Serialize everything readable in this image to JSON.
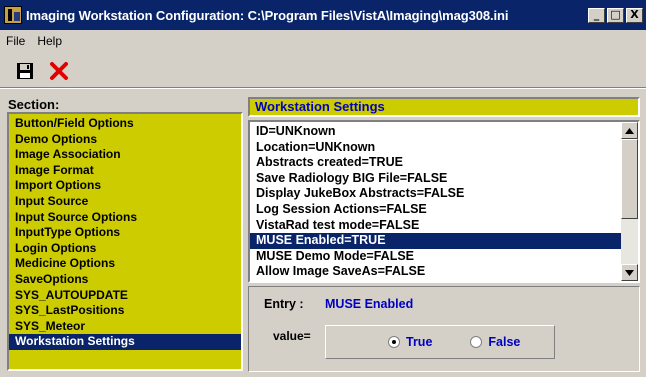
{
  "window": {
    "title": "Imaging Workstation Configuration:  C:\\Program Files\\VistA\\Imaging\\mag308.ini",
    "minimize_glyph": "_",
    "maximize_glyph": "□",
    "close_glyph": "X"
  },
  "menu": [
    "File",
    "Help"
  ],
  "toolbar": {
    "save_icon": "floppy-disk-icon",
    "cancel_icon": "red-x-icon"
  },
  "section": {
    "label": "Section:",
    "items": [
      "Button/Field Options",
      "Demo Options",
      "Image Association",
      "Image Format",
      "Import Options",
      "Input Source",
      "Input Source Options",
      "InputType Options",
      "Login Options",
      "Medicine Options",
      "SaveOptions",
      "SYS_AUTOUPDATE",
      "SYS_LastPositions",
      "SYS_Meteor",
      "Workstation Settings"
    ],
    "selected_index": 14
  },
  "settings": {
    "header": "Workstation Settings",
    "items": [
      "ID=UNKnown",
      "Location=UNKnown",
      "Abstracts created=TRUE",
      "Save Radiology BIG File=FALSE",
      "Display JukeBox Abstracts=FALSE",
      "Log Session Actions=FALSE",
      "VistaRad test mode=FALSE",
      "MUSE Enabled=TRUE",
      "MUSE Demo Mode=FALSE",
      "Allow Image SaveAs=FALSE"
    ],
    "selected_index": 7
  },
  "entry": {
    "label": "Entry :",
    "value": "MUSE Enabled",
    "value_label": "value=",
    "options": [
      "True",
      "False"
    ],
    "selected_option": "True"
  },
  "colors": {
    "title_bar": "#0a246a",
    "list_background": "#cccc00",
    "selection": "#0a246a",
    "accent_text": "#0000c0"
  }
}
